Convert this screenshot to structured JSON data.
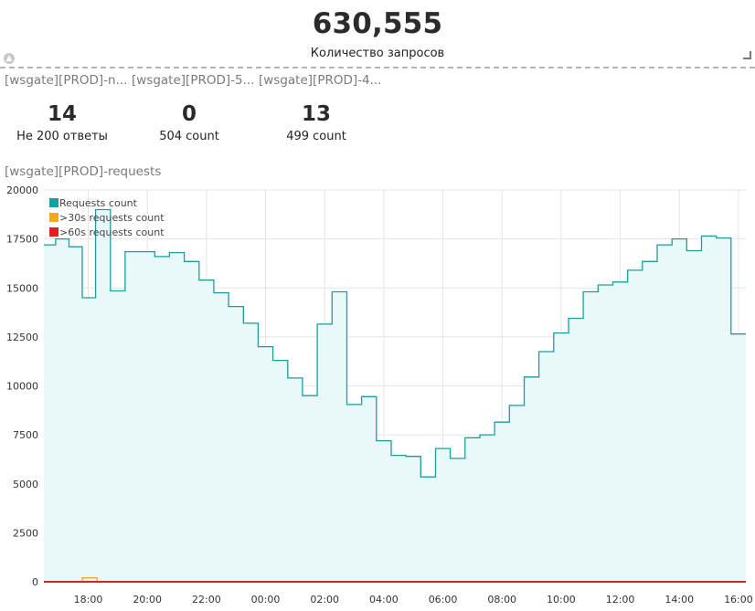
{
  "header": {
    "value": "630,555",
    "label": "Количество запросов"
  },
  "panel_tabs": [
    "[wsgate][PROD]-n...",
    "[wsgate][PROD]-5...",
    "[wsgate][PROD]-4..."
  ],
  "stats": [
    {
      "value": "14",
      "label": "Не 200 ответы"
    },
    {
      "value": "0",
      "label": "504 count"
    },
    {
      "value": "13",
      "label": "499 count"
    }
  ],
  "chart_title": "[wsgate][PROD]-requests",
  "colors": {
    "requests": "#1a9e9e",
    "requests_fill": "#e9f9fa",
    "over30": "#f5a623",
    "over60": "#e02020",
    "grid": "#e4e4e4"
  },
  "icons": {
    "collapse": "chevron-up-icon",
    "resize": "resize-corner-icon"
  },
  "chart_data": {
    "type": "area",
    "step": true,
    "title": "[wsgate][PROD]-requests",
    "ylim": [
      0,
      20000
    ],
    "yticks": [
      "0",
      "2500",
      "5000",
      "7500",
      "10000",
      "12500",
      "15000",
      "17500",
      "20000"
    ],
    "xlim_hours": [
      16.5,
      40.25
    ],
    "xticks": [
      {
        "label": "18:00",
        "h": 18
      },
      {
        "label": "20:00",
        "h": 20
      },
      {
        "label": "22:00",
        "h": 22
      },
      {
        "label": "00:00",
        "h": 24
      },
      {
        "label": "02:00",
        "h": 26
      },
      {
        "label": "04:00",
        "h": 28
      },
      {
        "label": "06:00",
        "h": 30
      },
      {
        "label": "08:00",
        "h": 32
      },
      {
        "label": "10:00",
        "h": 34
      },
      {
        "label": "12:00",
        "h": 36
      },
      {
        "label": "14:00",
        "h": 38
      },
      {
        "label": "16:00",
        "h": 40
      }
    ],
    "grid": true,
    "legend_position": "top-left",
    "series": [
      {
        "name": "Requests count",
        "color": "#1a9e9e",
        "points": [
          [
            16.5,
            17200
          ],
          [
            16.9,
            17500
          ],
          [
            17.35,
            17100
          ],
          [
            17.8,
            14500
          ],
          [
            18.25,
            19000
          ],
          [
            18.75,
            14850
          ],
          [
            19.25,
            16850
          ],
          [
            20.25,
            16600
          ],
          [
            20.75,
            16800
          ],
          [
            21.25,
            16350
          ],
          [
            21.75,
            15400
          ],
          [
            22.25,
            14750
          ],
          [
            22.75,
            14050
          ],
          [
            23.25,
            13200
          ],
          [
            23.75,
            12000
          ],
          [
            24.25,
            11300
          ],
          [
            24.75,
            10400
          ],
          [
            25.25,
            9500
          ],
          [
            25.75,
            13150
          ],
          [
            26.25,
            14800
          ],
          [
            26.75,
            9050
          ],
          [
            27.25,
            9450
          ],
          [
            27.75,
            7200
          ],
          [
            28.25,
            6450
          ],
          [
            28.75,
            6400
          ],
          [
            29.25,
            5350
          ],
          [
            29.75,
            6800
          ],
          [
            30.25,
            6300
          ],
          [
            30.75,
            7350
          ],
          [
            31.25,
            7500
          ],
          [
            31.75,
            8150
          ],
          [
            32.25,
            9000
          ],
          [
            32.75,
            10450
          ],
          [
            33.25,
            11750
          ],
          [
            33.75,
            12700
          ],
          [
            34.25,
            13450
          ],
          [
            34.75,
            14800
          ],
          [
            35.25,
            15150
          ],
          [
            35.75,
            15300
          ],
          [
            36.25,
            15900
          ],
          [
            36.75,
            16350
          ],
          [
            37.25,
            17200
          ],
          [
            37.75,
            17500
          ],
          [
            38.25,
            16900
          ],
          [
            38.75,
            17650
          ],
          [
            39.25,
            17550
          ],
          [
            39.75,
            12650
          ],
          [
            40.25,
            12650
          ]
        ]
      },
      {
        "name": ">30s requests count",
        "color": "#f5a623",
        "points": [
          [
            16.5,
            0
          ],
          [
            17.75,
            0
          ],
          [
            17.8,
            200
          ],
          [
            18.25,
            200
          ],
          [
            18.3,
            0
          ],
          [
            40.25,
            0
          ]
        ]
      },
      {
        "name": ">60s requests count",
        "color": "#e02020",
        "points": [
          [
            16.5,
            0
          ],
          [
            40.25,
            0
          ]
        ]
      }
    ]
  }
}
